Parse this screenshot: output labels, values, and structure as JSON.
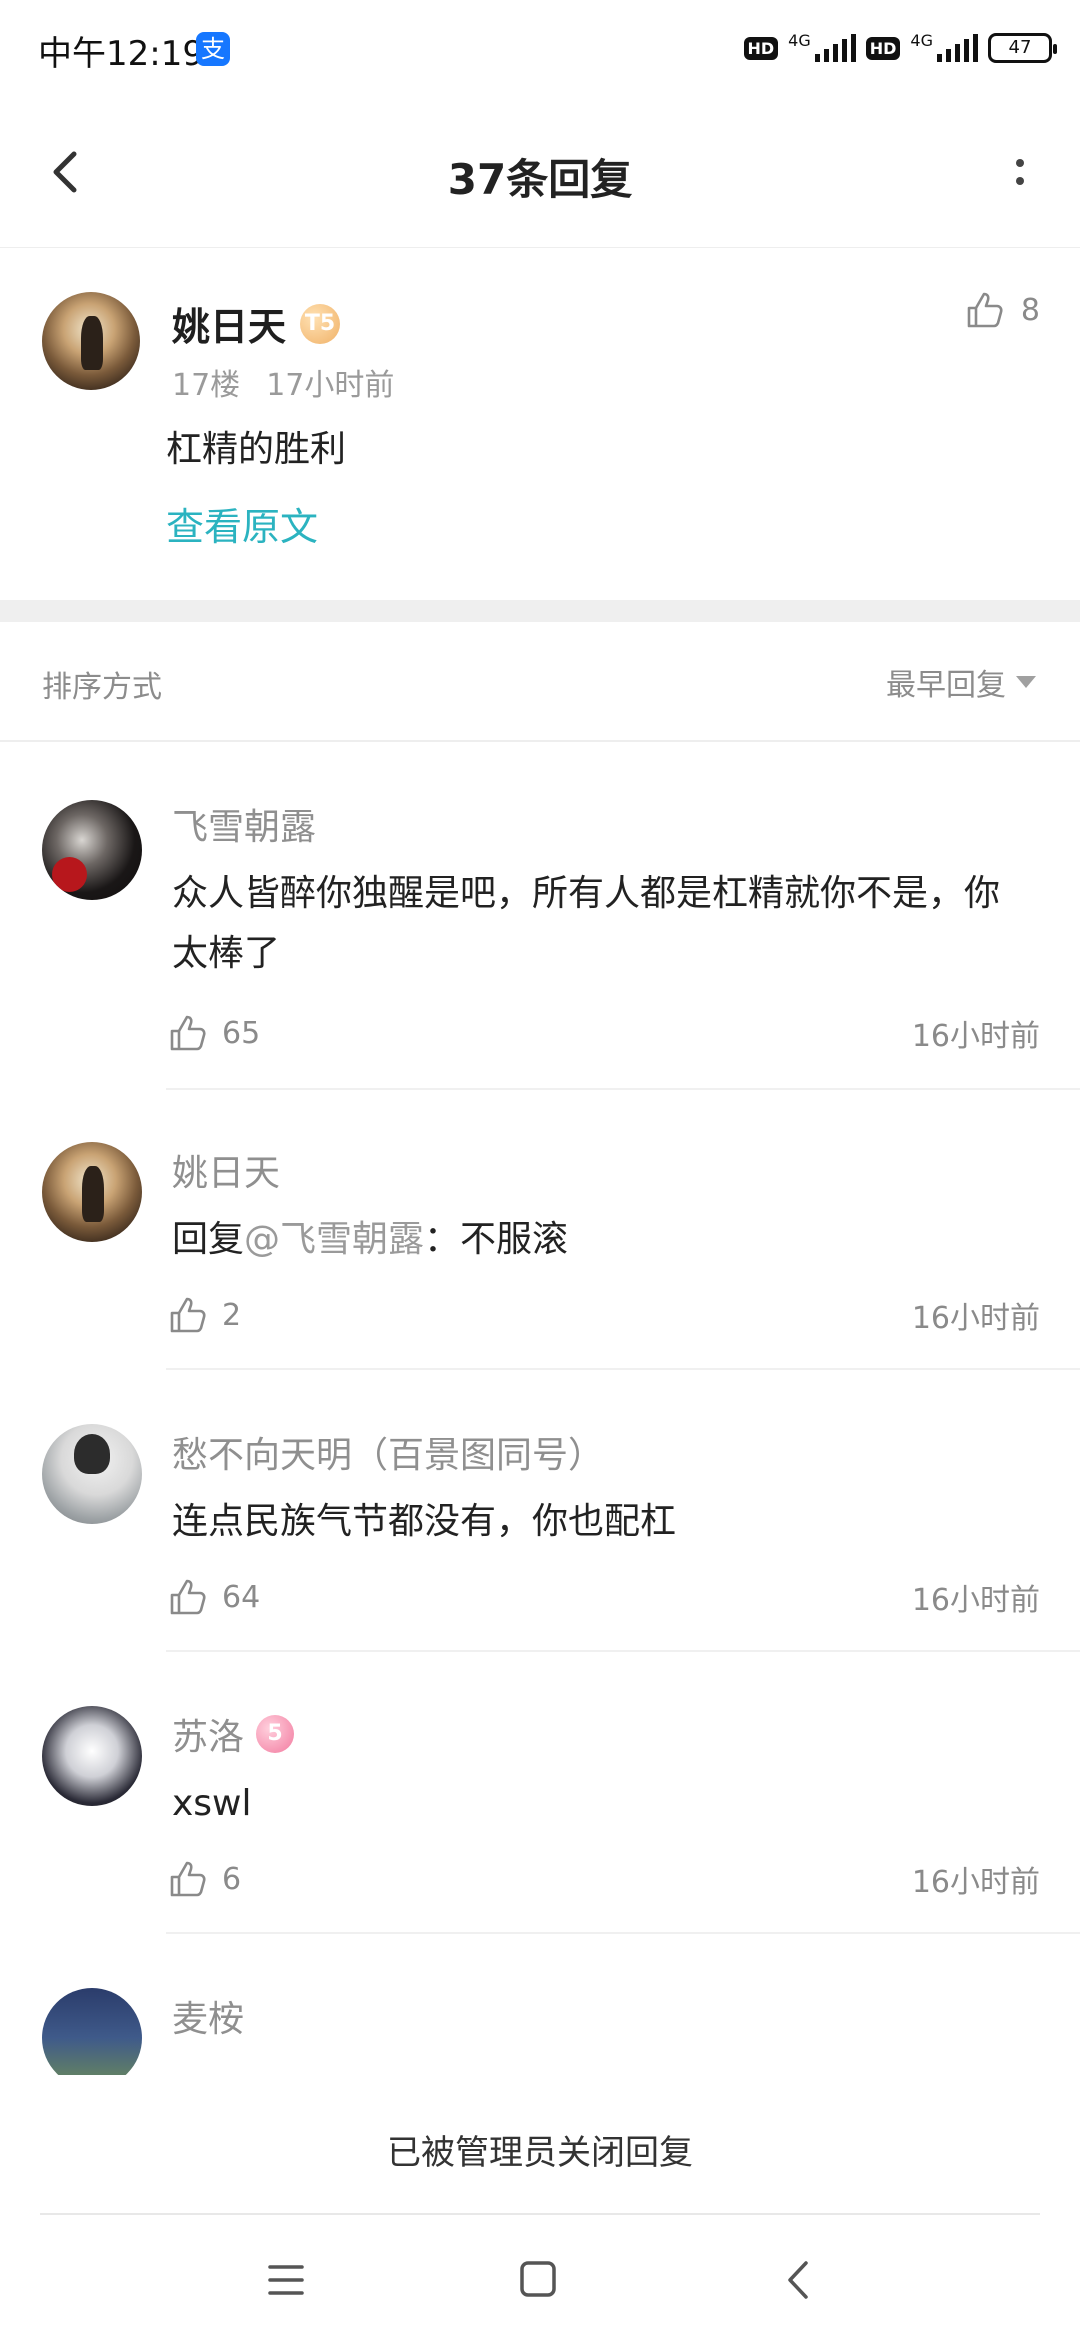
{
  "status_bar": {
    "time": "中午12:19",
    "alipay_glyph": "支",
    "hd1": "HD",
    "net1": "4G",
    "hd2": "HD",
    "net2": "4G",
    "battery": "47"
  },
  "header": {
    "title": "37条回复",
    "back_icon": "back-chevron-icon",
    "more_icon": "more-vertical-icon"
  },
  "main_post": {
    "author": "姚日天",
    "level_badge": "T5",
    "floor": "17楼",
    "time": "17小时前",
    "content": "杠精的胜利",
    "view_original": "查看原文",
    "likes": "8"
  },
  "sort": {
    "label": "排序方式",
    "value": "最早回复"
  },
  "replies": [
    {
      "author": "飞雪朝露",
      "text": "众人皆醉你独醒是吧，所有人都是杠精就你不是，你太棒了",
      "likes": "65",
      "time": "16小时前"
    },
    {
      "author": "姚日天",
      "reply_prefix": "回复",
      "mention": "@飞雪朝露",
      "text": "：不服滚",
      "likes": "2",
      "time": "16小时前"
    },
    {
      "author": "愁不向天明（百景图同号）",
      "text": "连点民族气节都没有，你也配杠",
      "likes": "64",
      "time": "16小时前"
    },
    {
      "author": "苏洛",
      "badge": "5",
      "text": "xswl",
      "likes": "6",
      "time": "16小时前"
    },
    {
      "author": "麦桉"
    }
  ],
  "closed_notice": "已被管理员关闭回复",
  "nav": {
    "menu_icon": "menu-icon",
    "home_icon": "home-square-icon",
    "back_icon": "nav-back-icon"
  },
  "colors": {
    "link": "#2bb3c0",
    "muted": "#8a8a8a",
    "divider": "#efefef"
  }
}
